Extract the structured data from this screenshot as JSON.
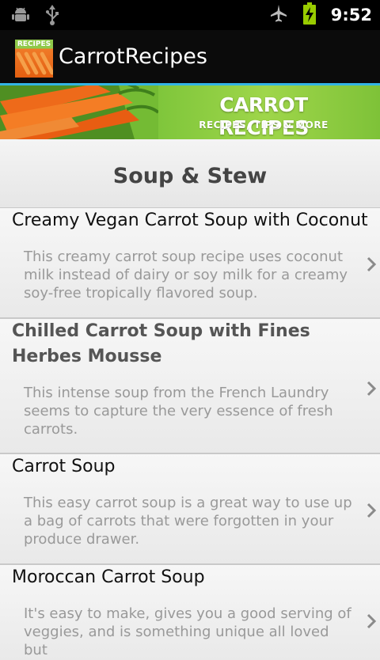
{
  "status_bar": {
    "time": "9:52",
    "left_icons": [
      "android-debug-icon",
      "usb-icon"
    ],
    "right_icons": [
      "airplane-mode-icon",
      "battery-charging-icon"
    ]
  },
  "app": {
    "title": "CarrotRecipes",
    "icon_label": "RECIPES",
    "accent_color": "#33b5e5"
  },
  "banner": {
    "title": "CARROT RECIPES",
    "subtitle": "RECIPES, TIPS & MORE",
    "color": "#7dc53a"
  },
  "section": {
    "title": "Soup & Stew"
  },
  "recipes": [
    {
      "title": "Creamy Vegan Carrot Soup with Coconut",
      "description": "This creamy carrot soup recipe uses coconut milk instead of dairy or soy milk for a creamy soy-free tropically flavored soup."
    },
    {
      "title": "Chilled Carrot Soup with Fines Herbes Mousse",
      "description": "This intense soup from the French Laundry seems to capture the very essence of fresh carrots."
    },
    {
      "title": "Carrot Soup",
      "description": "This easy carrot soup is a great way to use up a bag of carrots that were forgotten in your produce drawer."
    },
    {
      "title": "Moroccan Carrot Soup",
      "description": "It's easy to make, gives you a good serving of veggies, and is something unique all loved but"
    }
  ]
}
